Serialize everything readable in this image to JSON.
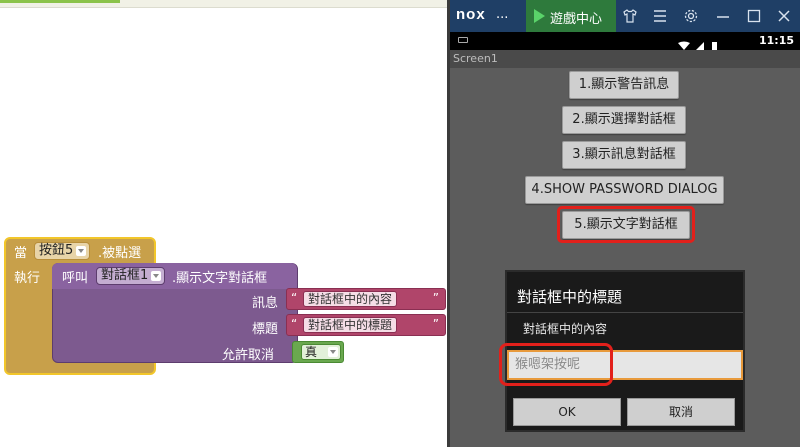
{
  "blocks": {
    "event": {
      "when": "當",
      "component": "按鈕5",
      "event_name": ".被點選",
      "do": "執行"
    },
    "call": {
      "call_label": "呼叫",
      "component": "對話框1",
      "method": ".顯示文字對話框",
      "params": [
        {
          "name": "訊息",
          "value": "對話框中的內容"
        },
        {
          "name": "標題",
          "value": "對話框中的標題"
        }
      ],
      "cancelable_label": "允許取消",
      "cancelable_value": "真"
    },
    "quote": "“",
    "quote_close": "”"
  },
  "emulator": {
    "logo": "nox",
    "dots": "...",
    "game_center": "遊戲中心",
    "clock": "11:15",
    "screen_title": "Screen1",
    "buttons": [
      "1.顯示警告訊息",
      "2.顯示選擇對話框",
      "3.顯示訊息對話框",
      "4.SHOW PASSWORD DIALOG",
      "5.顯示文字對話框"
    ],
    "dialog": {
      "title": "對話框中的標題",
      "message": "對話框中的內容",
      "input_value": "猴嗯架按呢",
      "ok": "OK",
      "cancel": "取消"
    }
  },
  "colors": {
    "event_block": "#c8a04a",
    "procedure_block": "#7d5a8f",
    "text_block": "#b0456a",
    "logic_block": "#6aa84f",
    "highlight": "#e2201b"
  }
}
